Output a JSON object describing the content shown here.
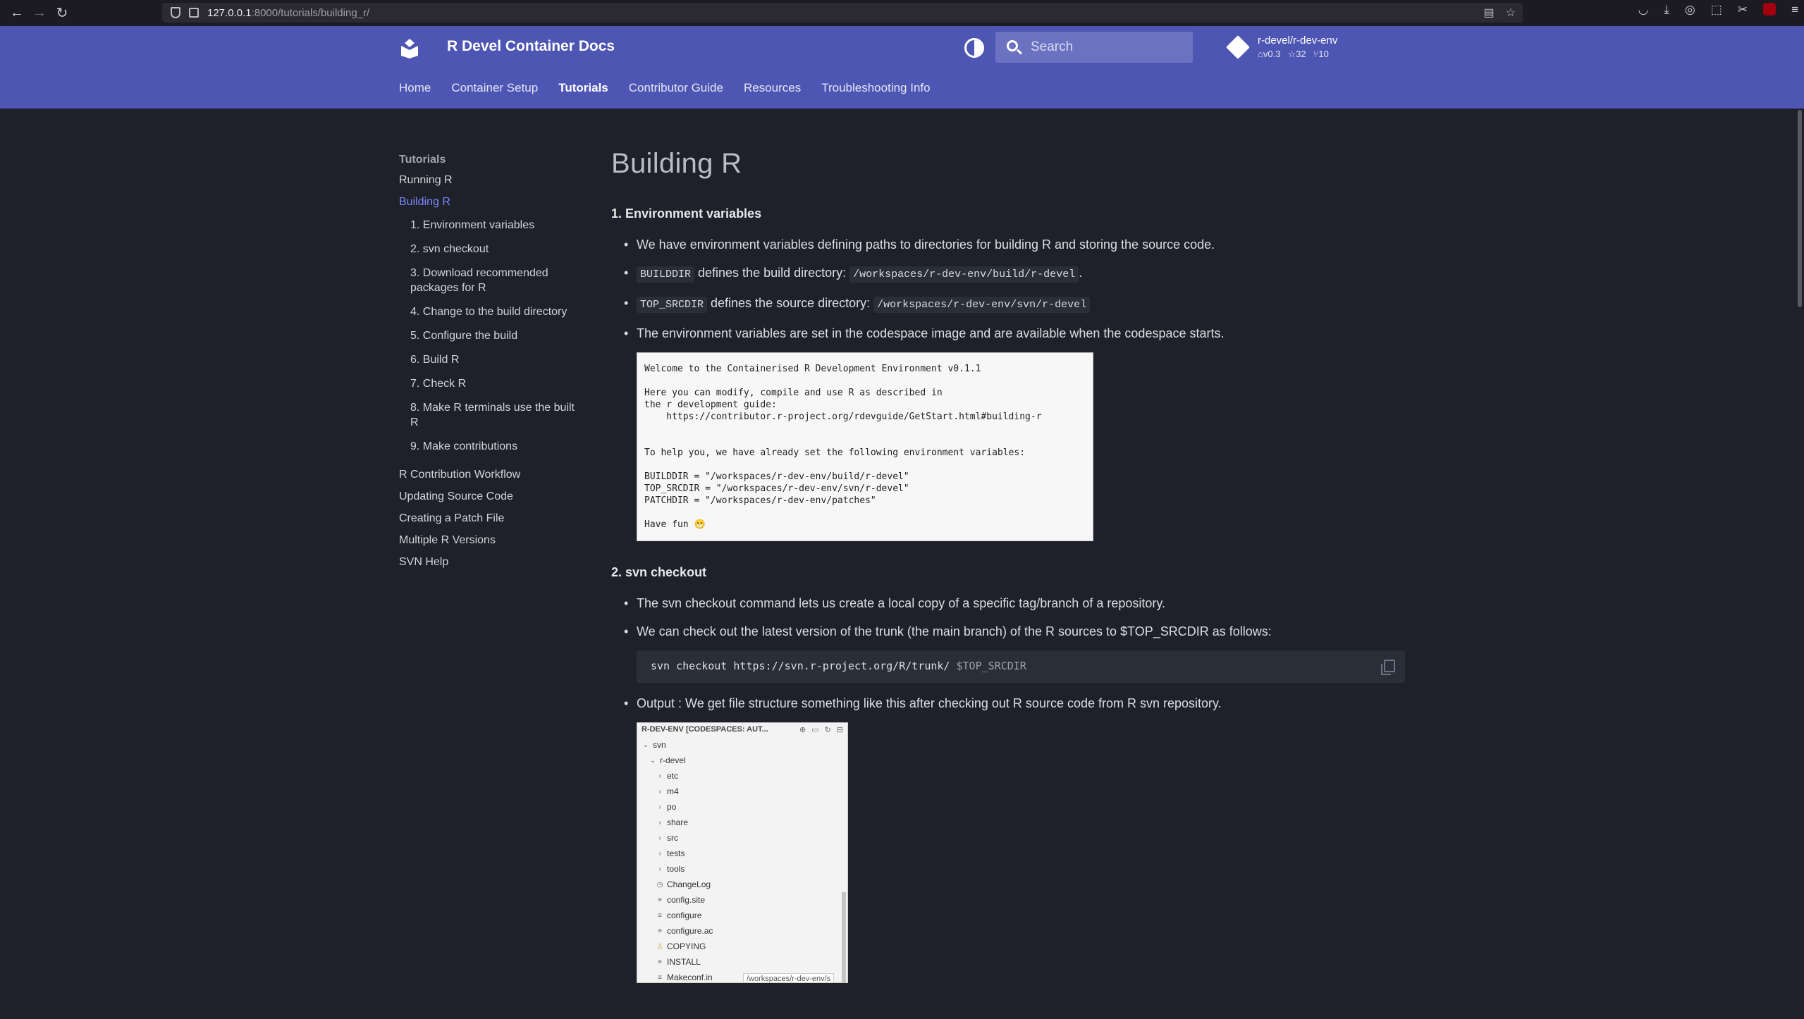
{
  "browser": {
    "url_host": "127.0.0.1",
    "url_rest": ":8000/tutorials/building_r/"
  },
  "header": {
    "site_title": "R Devel Container Docs",
    "search_placeholder": "Search",
    "repo": {
      "name": "r-devel/r-dev-env",
      "version": "v0.3",
      "stars": "32",
      "forks": "10"
    },
    "tabs": [
      "Home",
      "Container Setup",
      "Tutorials",
      "Contributor Guide",
      "Resources",
      "Troubleshooting Info"
    ],
    "active_tab": "Tutorials"
  },
  "sidebar": {
    "heading": "Tutorials",
    "running": "Running R",
    "building": "Building R",
    "toc": [
      "1. Environment variables",
      "2. svn checkout",
      "3. Download recommended packages for R",
      "4. Change to the build directory",
      "5. Configure the build",
      "6. Build R",
      "7. Check R",
      "8. Make R terminals use the built R",
      "9. Make contributions"
    ],
    "more": [
      "R Contribution Workflow",
      "Updating Source Code",
      "Creating a Patch File",
      "Multiple R Versions",
      "SVN Help"
    ]
  },
  "main": {
    "title": "Building R",
    "s1": {
      "heading": "1. Environment variables",
      "b1": "We have environment variables defining paths to directories for building R and storing the source code.",
      "b2_code": "BUILDDIR",
      "b2_text": " defines the build directory: ",
      "b2_path": "/workspaces/r-dev-env/build/r-devel",
      "b2_end": ".",
      "b3_code": "TOP_SRCDIR",
      "b3_text": " defines the source directory: ",
      "b3_path": "/workspaces/r-dev-env/svn/r-devel",
      "b4": "The environment variables are set in the codespace image and are available when the codespace starts.",
      "terminal": "Welcome to the Containerised R Development Environment v0.1.1\n\nHere you can modify, compile and use R as described in\nthe r development guide:\n    https://contributor.r-project.org/rdevguide/GetStart.html#building-r\n\n\nTo help you, we have already set the following environment variables:\n\nBUILDDIR = \"/workspaces/r-dev-env/build/r-devel\"\nTOP_SRCDIR = \"/workspaces/r-dev-env/svn/r-devel\"\nPATCHDIR = \"/workspaces/r-dev-env/patches\"\n\nHave fun 😁"
    },
    "s2": {
      "heading": "2. svn checkout",
      "b1": "The svn checkout command lets us create a local copy of a specific tag/branch of a repository.",
      "b2": "We can check out the latest version of the trunk (the main branch) of the R sources to $TOP_SRCDIR as follows:",
      "cmd": "svn checkout https://svn.r-project.org/R/trunk/ ",
      "cmd_var": "$TOP_SRCDIR",
      "b3": "Output : We get file structure something like this after checking out R source code from R svn repository."
    },
    "explorer": {
      "title": "R-DEV-ENV [CODESPACES: AUT...",
      "rows": [
        {
          "name": "svn",
          "indent": 0,
          "kind": "open"
        },
        {
          "name": "r-devel",
          "indent": 1,
          "kind": "open"
        },
        {
          "name": "etc",
          "indent": 2,
          "kind": "closed"
        },
        {
          "name": "m4",
          "indent": 2,
          "kind": "closed"
        },
        {
          "name": "po",
          "indent": 2,
          "kind": "closed"
        },
        {
          "name": "share",
          "indent": 2,
          "kind": "closed"
        },
        {
          "name": "src",
          "indent": 2,
          "kind": "closed"
        },
        {
          "name": "tests",
          "indent": 2,
          "kind": "closed"
        },
        {
          "name": "tools",
          "indent": 2,
          "kind": "closed"
        },
        {
          "name": "ChangeLog",
          "indent": 2,
          "kind": "file-clock"
        },
        {
          "name": "config.site",
          "indent": 2,
          "kind": "file"
        },
        {
          "name": "configure",
          "indent": 2,
          "kind": "file"
        },
        {
          "name": "configure.ac",
          "indent": 2,
          "kind": "file"
        },
        {
          "name": "COPYING",
          "indent": 2,
          "kind": "file-license"
        },
        {
          "name": "INSTALL",
          "indent": 2,
          "kind": "file"
        },
        {
          "name": "Makeconf.in",
          "indent": 2,
          "kind": "file"
        }
      ],
      "tooltip": "/workspaces/r-dev-env/s"
    }
  }
}
